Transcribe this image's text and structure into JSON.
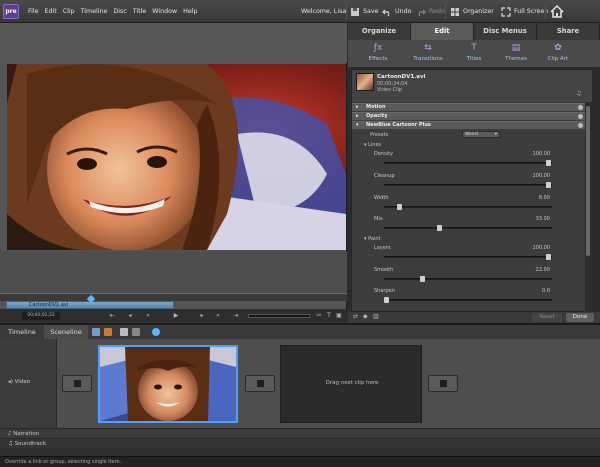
{
  "app": {
    "logo_text": "pre"
  },
  "menu": [
    "File",
    "Edit",
    "Clip",
    "Timeline",
    "Disc",
    "Title",
    "Window",
    "Help"
  ],
  "welcome": "Welcome, Lisa",
  "toolbar": {
    "save": "Save",
    "undo": "Undo",
    "redo": "Redo",
    "organizer": "Organizer",
    "fullscreen": "Full Screen"
  },
  "monitor": {
    "clip_name": "CartoonDV1.avi",
    "timecode": "00;00;02;22"
  },
  "panel": {
    "tabs": [
      "Organize",
      "Edit",
      "Disc Menus",
      "Share"
    ],
    "active_tab": "Edit",
    "subtabs": [
      "Effects",
      "Transitions",
      "Titles",
      "Themes",
      "Clip Art"
    ],
    "clip": {
      "name": "CartoonDV1.avi",
      "duration": "00;00;24;04",
      "type": "Video Clip"
    },
    "sections": [
      "Motion",
      "Opacity",
      "NewBlue Cartoonr Plus"
    ],
    "presets_label": "Presets",
    "presets_value": "Weird",
    "groups": [
      "Lines",
      "Paint"
    ],
    "params": [
      {
        "label": "Density",
        "value": "100.00",
        "fraction": 0.98
      },
      {
        "label": "Cleanup",
        "value": "100.00",
        "fraction": 0.98
      },
      {
        "label": "Width",
        "value": "8.00",
        "fraction": 0.08
      },
      {
        "label": "Mix",
        "value": "33.00",
        "fraction": 0.33
      },
      {
        "label": "Layers",
        "value": "100.00",
        "fraction": 0.98
      },
      {
        "label": "Smooth",
        "value": "22.00",
        "fraction": 0.22
      },
      {
        "label": "Sharpen",
        "value": "0.0",
        "fraction": 0.0
      }
    ],
    "reset": "Reset",
    "done": "Done"
  },
  "timeline": {
    "tabs": [
      "Timeline",
      "Sceneline"
    ],
    "active_tab": "Sceneline",
    "tracks": [
      "Video",
      "Narration",
      "Soundtrack"
    ],
    "drag_hint": "Drag next clip here"
  },
  "status": "Override a link or group, selecting single item."
}
